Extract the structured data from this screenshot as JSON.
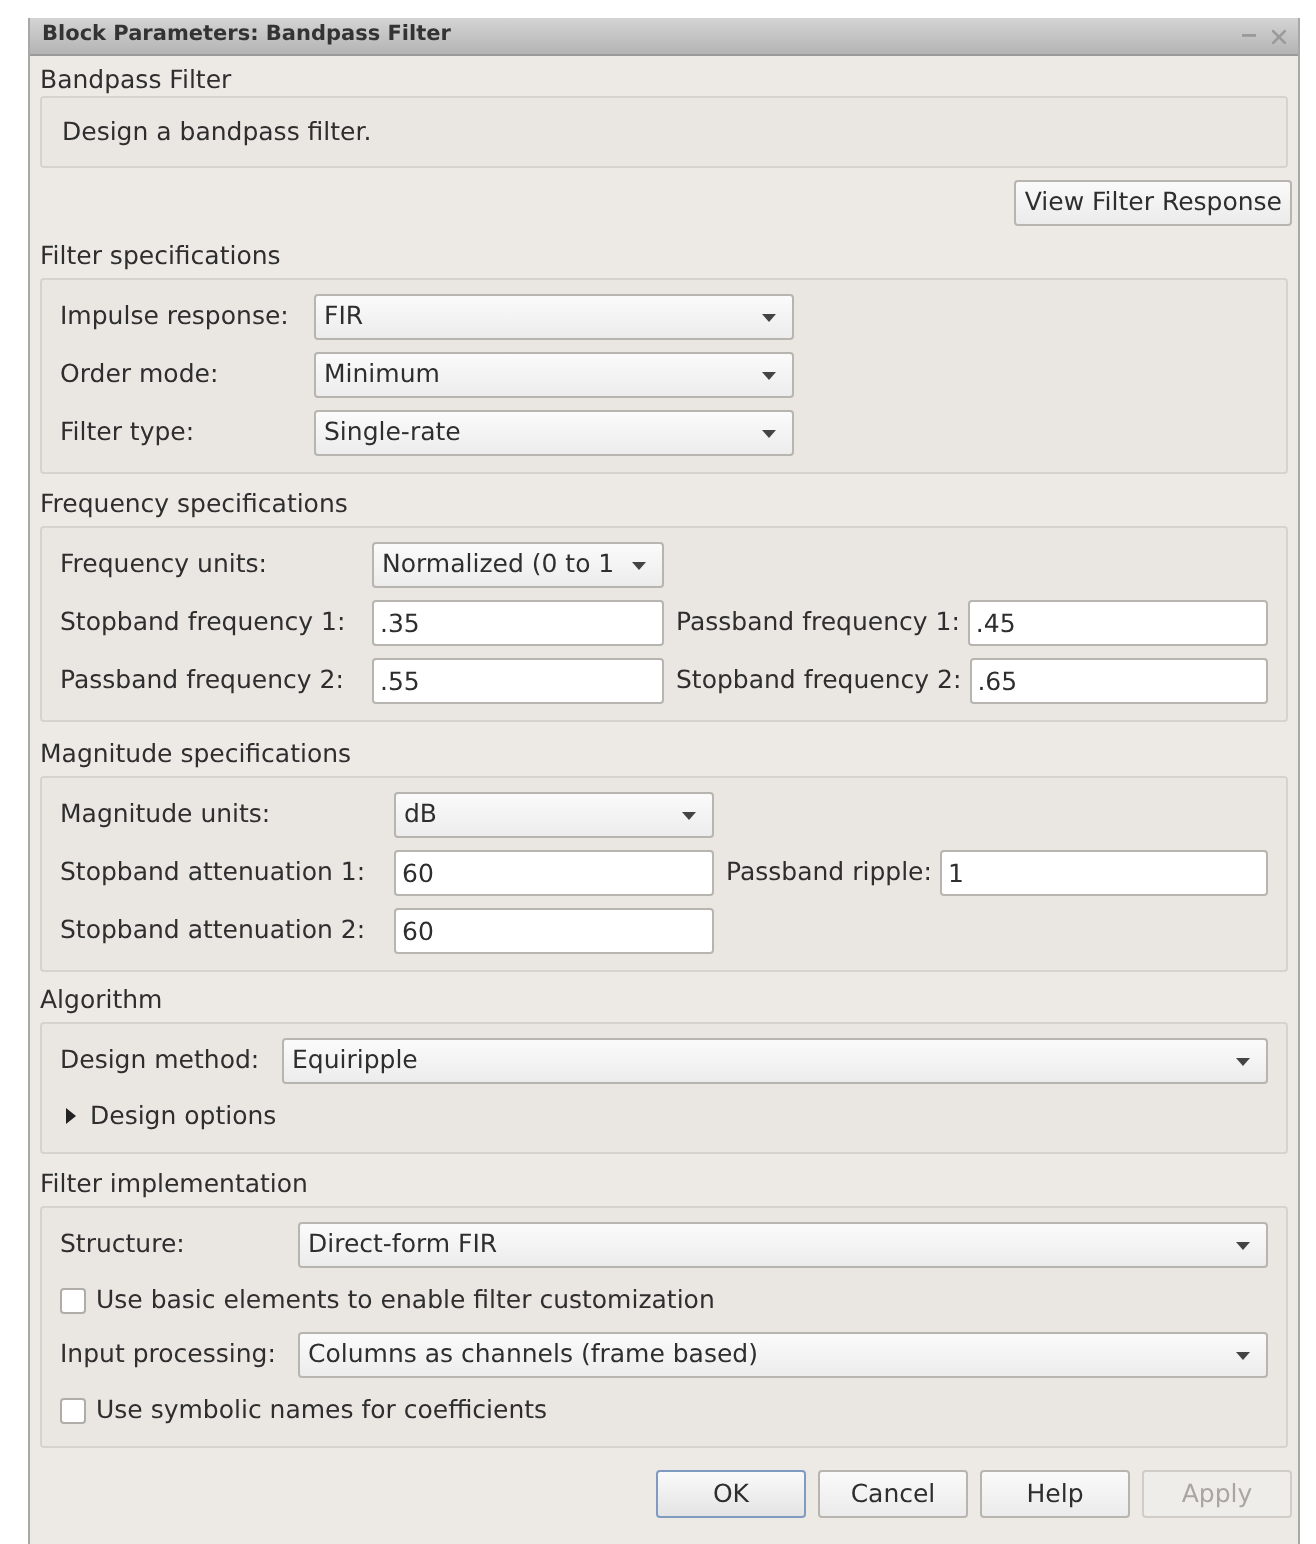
{
  "window": {
    "title": "Block Parameters: Bandpass Filter"
  },
  "block_name": "Bandpass Filter",
  "description": "Design a bandpass filter.",
  "view_button": "View Filter Response",
  "sections": [
    {
      "title": "Filter specifications",
      "rows": [
        {
          "kind": "dropdown",
          "label": "Impulse response:",
          "value": "FIR"
        },
        {
          "kind": "dropdown",
          "label": "Order mode:",
          "value": "Minimum"
        },
        {
          "kind": "dropdown",
          "label": "Filter type:",
          "value": "Single-rate"
        }
      ]
    },
    {
      "title": "Frequency specifications",
      "rows": [
        {
          "kind": "dropdown",
          "label": "Frequency units:",
          "value": "Normalized (0 to 1"
        },
        {
          "kind": "pair",
          "label": "Stopband frequency 1:",
          "value": ".35",
          "label_2": "Passband frequency 1:",
          "value_2": ".45"
        },
        {
          "kind": "pair",
          "label": "Passband frequency 2:",
          "value": ".55",
          "label_2": "Stopband frequency 2:",
          "value_2": ".65"
        }
      ]
    },
    {
      "title": "Magnitude specifications",
      "rows": [
        {
          "kind": "dropdown",
          "label": "Magnitude units:",
          "value": "dB"
        },
        {
          "kind": "pair",
          "label": "Stopband attenuation 1:",
          "value": "60",
          "label_2": "Passband ripple:",
          "value_2": "1"
        },
        {
          "kind": "field",
          "label": "Stopband attenuation 2:",
          "value": "60"
        }
      ]
    },
    {
      "title": "Algorithm",
      "rows": [
        {
          "kind": "dropdown",
          "label": "Design method:",
          "value": "Equiripple"
        },
        {
          "kind": "expander",
          "label": "Design options",
          "expanded": false
        }
      ]
    },
    {
      "title": "Filter implementation",
      "rows": [
        {
          "kind": "dropdown",
          "label": "Structure:",
          "value": "Direct-form FIR"
        },
        {
          "kind": "checkbox",
          "label": "Use basic elements to enable filter customization",
          "checked": false
        },
        {
          "kind": "dropdown",
          "label": "Input processing:",
          "value": "Columns as channels (frame based)"
        },
        {
          "kind": "checkbox",
          "label": "Use symbolic names for coefficients",
          "checked": false
        }
      ]
    }
  ],
  "buttons": [
    {
      "label": "OK",
      "disabled": false
    },
    {
      "label": "Cancel",
      "disabled": false
    },
    {
      "label": "Help",
      "disabled": false
    },
    {
      "label": "Apply",
      "disabled": true
    }
  ]
}
